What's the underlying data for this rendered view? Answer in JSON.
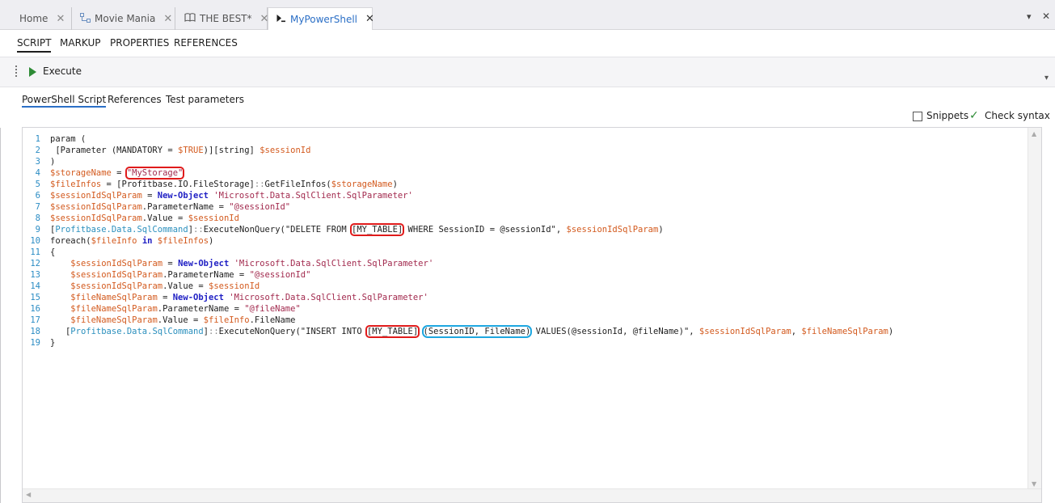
{
  "tabs": [
    {
      "label": "Home",
      "icon": "",
      "close": "✕",
      "active": false
    },
    {
      "label": "Movie Mania",
      "icon": "diagram-icon",
      "close": "✕",
      "active": false
    },
    {
      "label": "THE BEST*",
      "icon": "book-icon",
      "close": "✕",
      "active": false
    },
    {
      "label": "MyPowerShell",
      "icon": "powershell-icon",
      "close": "✕",
      "active": true
    }
  ],
  "tabbar": {
    "dropdown": "▾",
    "close": "✕"
  },
  "sections": [
    "SCRIPT",
    "MARKUP",
    "PROPERTIES",
    "REFERENCES"
  ],
  "toolbar": {
    "execute_label": "Execute",
    "overflow": "▾"
  },
  "subtabs": [
    "PowerShell Script",
    "References",
    "Test parameters"
  ],
  "editor_options": {
    "snippets_label": "Snippets",
    "snippets_checked": false,
    "check_syntax_label": "Check syntax"
  },
  "colors": {
    "accent": "#2b6fc6",
    "execute_green": "#2e8b36",
    "highlight_red": "#e01b1b",
    "highlight_blue": "#1ea7e0"
  },
  "code_lines": [
    [
      [
        "pa",
        "param ("
      ]
    ],
    [
      [
        "pa",
        " [Parameter (MANDATORY = "
      ],
      [
        "var",
        "$TRUE"
      ],
      [
        "pa",
        ")][string] "
      ],
      [
        "var",
        "$sessionId"
      ]
    ],
    [
      [
        "pa",
        ")"
      ]
    ],
    [
      [
        "var",
        "$storageName"
      ],
      [
        "pa",
        " = "
      ],
      [
        "str",
        "\"MyStorage\"",
        "red"
      ]
    ],
    [
      [
        "var",
        "$fileInfos"
      ],
      [
        "pa",
        " = [Profitbase.IO.FileStorage]"
      ],
      [
        "op",
        "::"
      ],
      [
        "pa",
        "GetFileInfos("
      ],
      [
        "var",
        "$storageName"
      ],
      [
        "pa",
        ")"
      ]
    ],
    [
      [
        "var",
        "$sessionIdSqlParam"
      ],
      [
        "pa",
        " = "
      ],
      [
        "kw",
        "New-Object"
      ],
      [
        "pa",
        " "
      ],
      [
        "str",
        "'Microsoft.Data.SqlClient.SqlParameter'"
      ]
    ],
    [
      [
        "var",
        "$sessionIdSqlParam"
      ],
      [
        "pa",
        ".ParameterName = "
      ],
      [
        "str",
        "\"@sessionId\""
      ]
    ],
    [
      [
        "var",
        "$sessionIdSqlParam"
      ],
      [
        "pa",
        ".Value = "
      ],
      [
        "var",
        "$sessionId"
      ]
    ],
    [
      [
        "pa",
        "["
      ],
      [
        "typ",
        "Profitbase.Data.SqlCommand"
      ],
      [
        "pa",
        "]"
      ],
      [
        "op",
        "::"
      ],
      [
        "pa",
        "ExecuteNonQuery(\"DELETE FROM "
      ],
      [
        "pa",
        "[MY_TABLE]",
        "red"
      ],
      [
        "pa",
        " WHERE SessionID = @sessionId\", "
      ],
      [
        "var",
        "$sessionIdSqlParam"
      ],
      [
        "pa",
        ")"
      ]
    ],
    [
      [
        "pa",
        "foreach("
      ],
      [
        "var",
        "$fileInfo"
      ],
      [
        "pa",
        " "
      ],
      [
        "kw",
        "in"
      ],
      [
        "pa",
        " "
      ],
      [
        "var",
        "$fileInfos"
      ],
      [
        "pa",
        ")"
      ]
    ],
    [
      [
        "pa",
        "{"
      ]
    ],
    [
      [
        "pa",
        "    "
      ],
      [
        "var",
        "$sessionIdSqlParam"
      ],
      [
        "pa",
        " = "
      ],
      [
        "kw",
        "New-Object"
      ],
      [
        "pa",
        " "
      ],
      [
        "str",
        "'Microsoft.Data.SqlClient.SqlParameter'"
      ]
    ],
    [
      [
        "pa",
        "    "
      ],
      [
        "var",
        "$sessionIdSqlParam"
      ],
      [
        "pa",
        ".ParameterName = "
      ],
      [
        "str",
        "\"@sessionId\""
      ]
    ],
    [
      [
        "pa",
        "    "
      ],
      [
        "var",
        "$sessionIdSqlParam"
      ],
      [
        "pa",
        ".Value = "
      ],
      [
        "var",
        "$sessionId"
      ]
    ],
    [
      [
        "pa",
        "    "
      ],
      [
        "var",
        "$fileNameSqlParam"
      ],
      [
        "pa",
        " = "
      ],
      [
        "kw",
        "New-Object"
      ],
      [
        "pa",
        " "
      ],
      [
        "str",
        "'Microsoft.Data.SqlClient.SqlParameter'"
      ]
    ],
    [
      [
        "pa",
        "    "
      ],
      [
        "var",
        "$fileNameSqlParam"
      ],
      [
        "pa",
        ".ParameterName = "
      ],
      [
        "str",
        "\"@fileName\""
      ]
    ],
    [
      [
        "pa",
        "    "
      ],
      [
        "var",
        "$fileNameSqlParam"
      ],
      [
        "pa",
        ".Value = "
      ],
      [
        "var",
        "$fileInfo"
      ],
      [
        "pa",
        ".FileName"
      ]
    ],
    [
      [
        "pa",
        "   ["
      ],
      [
        "typ",
        "Profitbase.Data.SqlCommand"
      ],
      [
        "pa",
        "]"
      ],
      [
        "op",
        "::"
      ],
      [
        "pa",
        "ExecuteNonQuery(\"INSERT INTO "
      ],
      [
        "pa",
        "[MY_TABLE]",
        "red"
      ],
      [
        "pa",
        " "
      ],
      [
        "pa",
        "(SessionID, FileName)",
        "blue"
      ],
      [
        "pa",
        " VALUES(@sessionId, @fileName)\", "
      ],
      [
        "var",
        "$sessionIdSqlParam"
      ],
      [
        "pa",
        ", "
      ],
      [
        "var",
        "$fileNameSqlParam"
      ],
      [
        "pa",
        ")"
      ]
    ],
    [
      [
        "pa",
        "}"
      ]
    ]
  ]
}
